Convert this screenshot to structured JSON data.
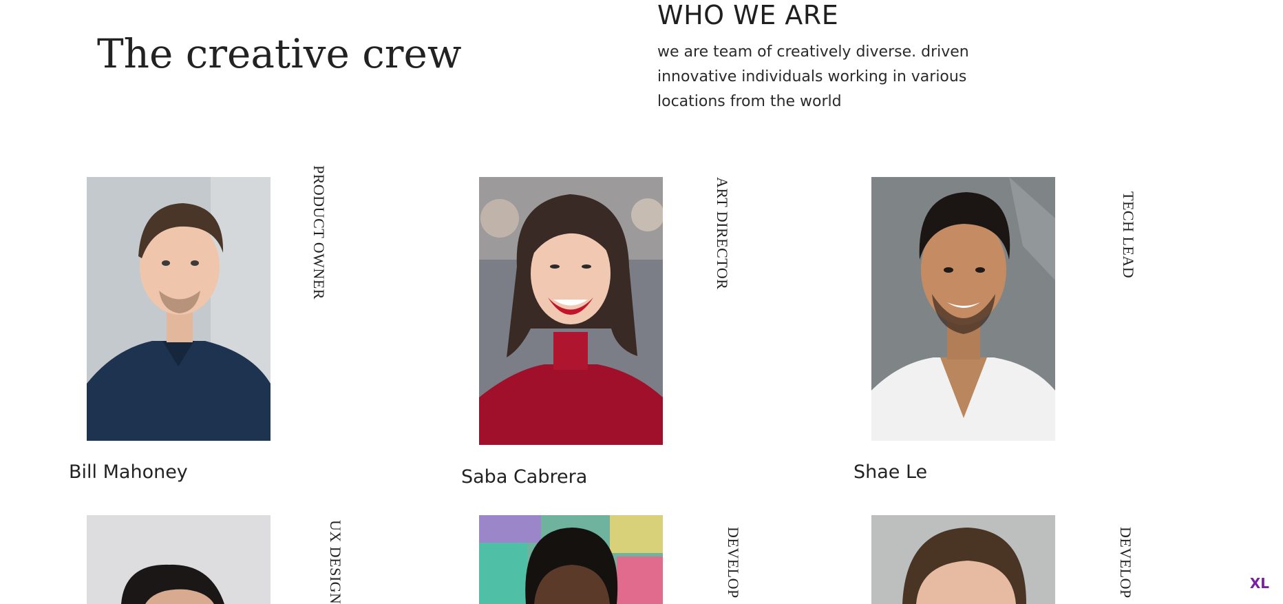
{
  "hero": {
    "title": "The creative crew"
  },
  "about": {
    "heading": "WHO WE ARE",
    "text": "we are team of creatively diverse. driven innovative individuals working in various locations from the world"
  },
  "members": [
    {
      "name": "Bill Mahoney",
      "role": "PRODUCT OWNER"
    },
    {
      "name": "Saba Cabrera",
      "role": "ART DIRECTOR"
    },
    {
      "name": "Shae Le",
      "role": "TECH LEAD"
    },
    {
      "name": "",
      "role": "UX DESIGN"
    },
    {
      "name": "",
      "role": "DEVELOP"
    },
    {
      "name": "",
      "role": "DEVELOP"
    }
  ],
  "badge": {
    "label": "XL",
    "color": "#7a1fa2"
  }
}
